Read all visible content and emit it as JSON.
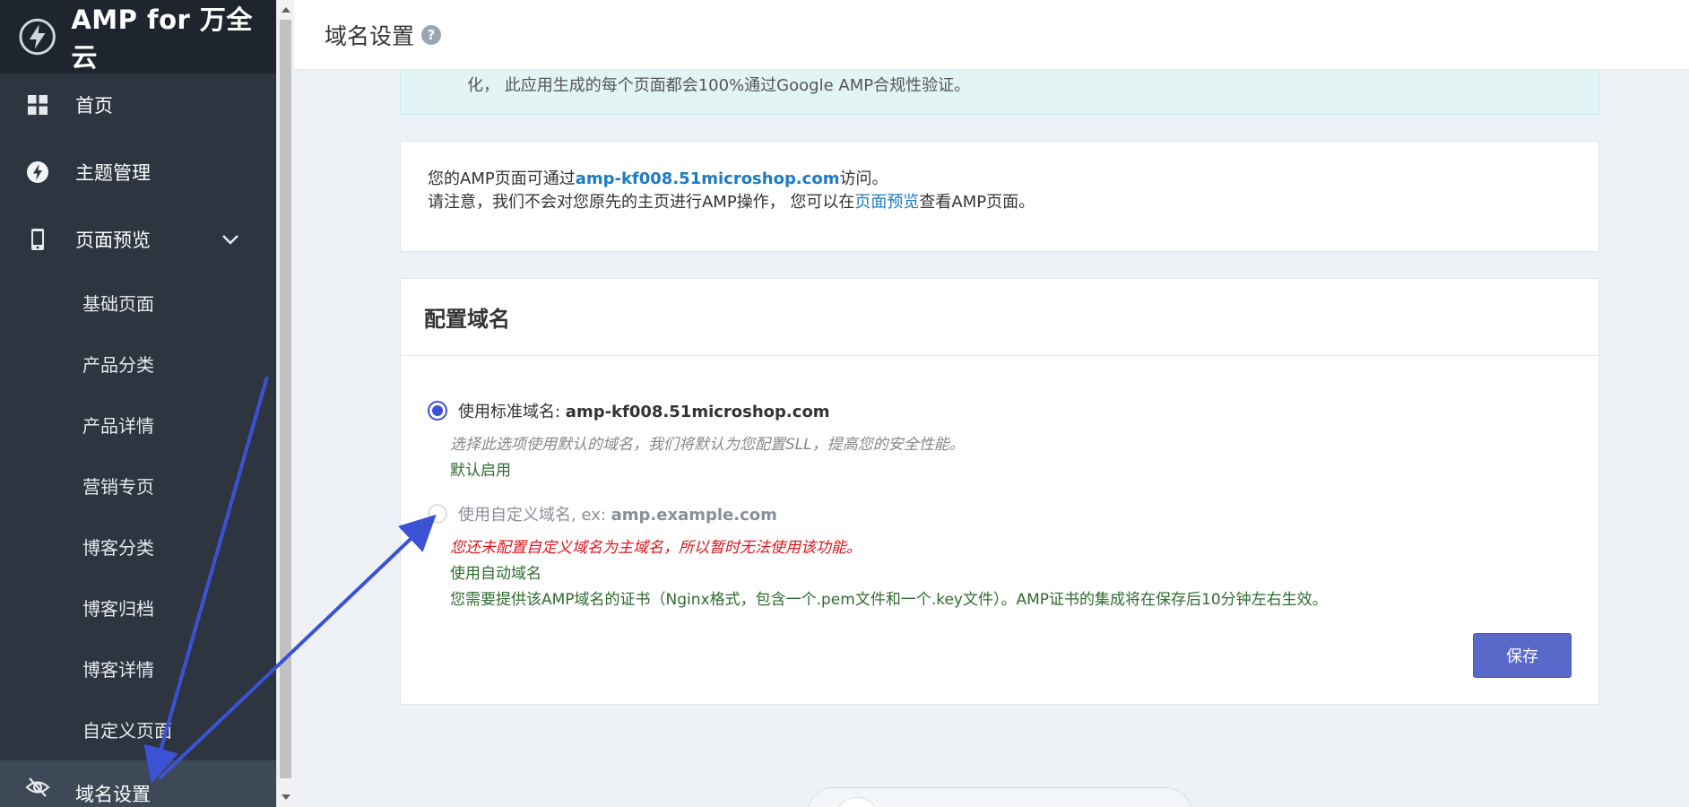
{
  "app": {
    "title": "AMP for 万全云"
  },
  "sidebar": {
    "items": [
      {
        "label": "首页",
        "icon": "dashboard-grid-icon"
      },
      {
        "label": "主题管理",
        "icon": "lightning-icon"
      },
      {
        "label": "页面预览",
        "icon": "mobile-phone-icon",
        "expanded": true
      },
      {
        "label": "基础页面"
      },
      {
        "label": "产品分类"
      },
      {
        "label": "产品详情"
      },
      {
        "label": "营销专页"
      },
      {
        "label": "博客分类"
      },
      {
        "label": "博客归档"
      },
      {
        "label": "博客详情"
      },
      {
        "label": "自定义页面"
      },
      {
        "label": "域名设置",
        "icon": "eye-slash-icon",
        "active": true
      }
    ]
  },
  "header": {
    "title": "域名设置",
    "help": "?"
  },
  "notice": {
    "text": "化， 此应用生成的每个页面都会100%通过Google AMP合规性验证。"
  },
  "info": {
    "line1_prefix": "您的AMP页面可通过",
    "domain": "amp-kf008.51microshop.com",
    "line1_suffix": "访问。",
    "line2_prefix": "请注意，我们不会对您原先的主页进行AMP操作， 您可以在",
    "preview_link": "页面预览",
    "line2_suffix": "查看AMP页面。"
  },
  "config": {
    "title": "配置域名",
    "option_standard": {
      "label": "使用标准域名: ",
      "domain": "amp-kf008.51microshop.com",
      "hint": "选择此选项使用默认的域名，我们将默认为您配置SLL，提高您的安全性能。",
      "status": "默认启用",
      "selected": true
    },
    "option_custom": {
      "label": "使用自定义域名, ex: ",
      "example": "amp.example.com",
      "warning": "您还未配置自定义域名为主域名，所以暂时无法使用该功能。",
      "auto": "使用自动域名",
      "cert_note": "您需要提供该AMP域名的证书（Nginx格式，包含一个.pem文件和一个.key文件）。AMP证书的集成将在保存后10分钟左右生效。",
      "selected": false
    },
    "save_label": "保存"
  },
  "colors": {
    "sidebar": "#2c3540",
    "accent": "#5a68c9",
    "arrow": "#3b52d6",
    "warning": "#e0141b",
    "success": "#2f6b2f"
  }
}
